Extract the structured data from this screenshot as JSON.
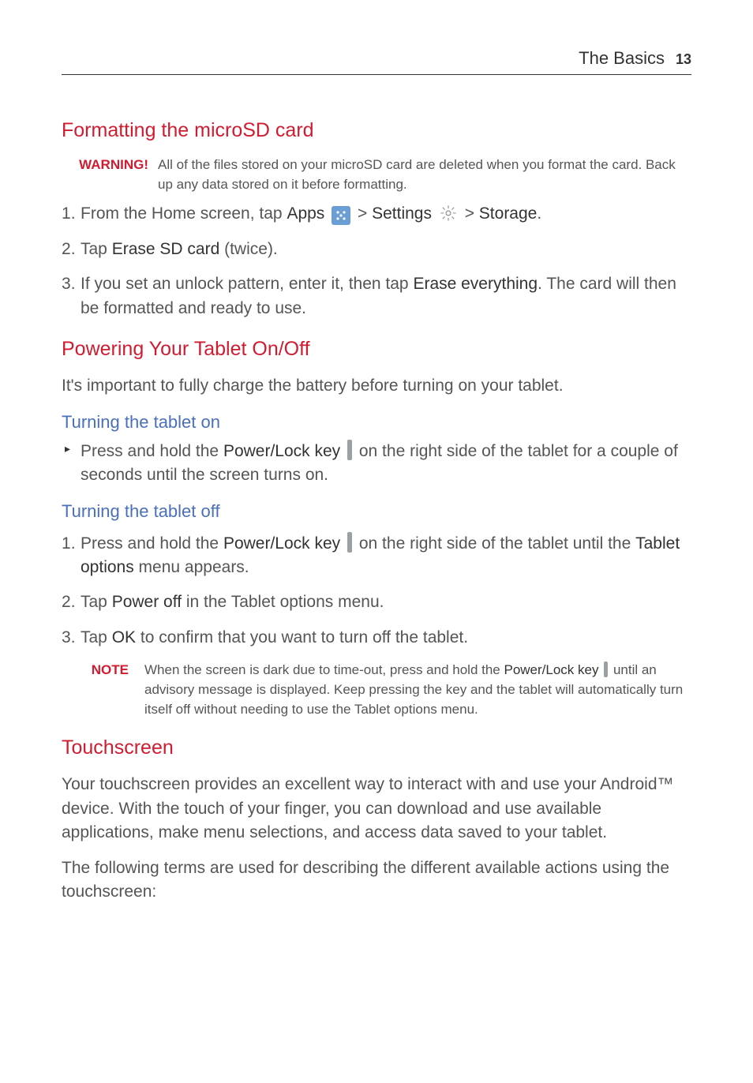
{
  "header": {
    "section": "The Basics",
    "page": "13"
  },
  "h_format": "Formatting the microSD card",
  "warn": {
    "label": "WARNING!",
    "text": "All of the files stored on your microSD card are deleted when you format the card. Back up any data stored on it before formatting."
  },
  "fmt": {
    "s1_pre": "From the Home screen, tap ",
    "apps": "Apps",
    "gt1": " > ",
    "settings": "Settings",
    "gt2": " > ",
    "storage": "Storage",
    "s1_end": ".",
    "s2_pre": "Tap ",
    "s2_bold": "Erase SD card",
    "s2_post": " (twice).",
    "s3_pre": "If you set an unlock pattern, enter it, then tap ",
    "s3_bold": "Erase everything",
    "s3_post": ". The card will then be formatted and ready to use."
  },
  "h_power": "Powering Your Tablet On/Off",
  "power_intro": "It's important to fully charge the battery before turning on your tablet.",
  "h_on": "Turning the tablet on",
  "on": {
    "pre": "Press and hold the ",
    "key": "Power/Lock key",
    "post": " on the right side of the tablet for a couple of seconds until the screen turns on."
  },
  "h_off": "Turning the tablet off",
  "off": {
    "s1_pre": "Press and hold the ",
    "s1_key": "Power/Lock key",
    "s1_mid": " on the right side of the tablet until the ",
    "s1_bold": "Tablet options",
    "s1_post": " menu appears.",
    "s2_pre": "Tap ",
    "s2_bold": "Power off",
    "s2_post": " in the Tablet options menu.",
    "s3_pre": "Tap ",
    "s3_bold": "OK",
    "s3_post": " to confirm that you want to turn off the tablet."
  },
  "note": {
    "label": "NOTE",
    "pre": "When the screen is dark due to time-out, press and hold the ",
    "key": "Power/Lock key",
    "post": " until an advisory message is displayed. Keep pressing the key and the tablet will automatically turn itself off without needing to use the Tablet options menu."
  },
  "h_touch": "Touchscreen",
  "touch_p1": "Your touchscreen provides an excellent way to interact with and use your Android™ device. With the touch of your finger, you can download and use available applications, make menu selections, and access data saved to your tablet.",
  "touch_p2": "The following terms are used for describing the different available actions using the touchscreen:"
}
